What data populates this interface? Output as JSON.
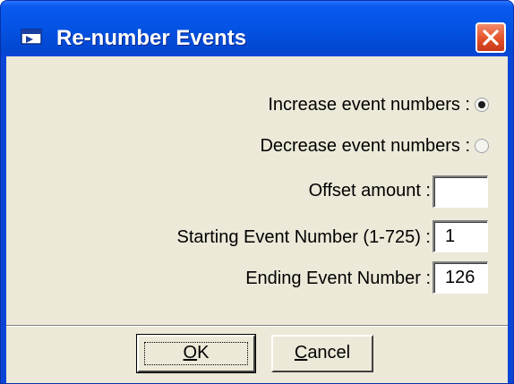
{
  "window": {
    "title": "Re-number Events",
    "close_icon": "close-icon",
    "app_icon": "dialog-icon"
  },
  "form": {
    "increase_label": "Increase event numbers :",
    "increase_selected": true,
    "decrease_label": "Decrease event numbers :",
    "decrease_selected": false,
    "offset_label": "Offset amount :",
    "offset_value": "",
    "starting_label": "Starting Event Number (1-725) :",
    "starting_value": "1",
    "ending_label": "Ending Event Number :",
    "ending_value": "126"
  },
  "buttons": {
    "ok_mnemonic": "O",
    "ok_rest": "K",
    "cancel_mnemonic": "C",
    "cancel_rest": "ancel"
  },
  "colors": {
    "titlebar": "#0a5af0",
    "client": "#ece9d8",
    "close": "#e2522a"
  }
}
